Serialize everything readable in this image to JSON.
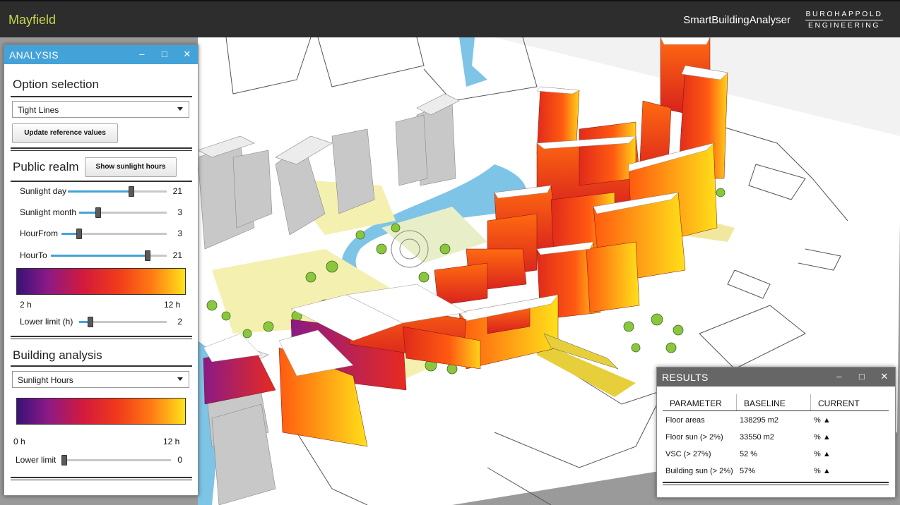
{
  "header": {
    "app_name": "Mayfield",
    "product_name": "SmartBuildingAnalyser",
    "brand_line1": "BUROHAPPOLD",
    "brand_line2": "ENGINEERING"
  },
  "analysis_panel": {
    "title": "ANALYSIS",
    "window_buttons": [
      "–",
      "□",
      "✕"
    ],
    "option_selection": {
      "heading": "Option selection",
      "dropdown_value": "Tight Lines",
      "update_button": "Update reference values"
    },
    "public_realm": {
      "heading": "Public realm",
      "show_button": "Show sunlight hours",
      "sliders": [
        {
          "label": "Sunlight day",
          "value": "21",
          "fraction": 0.65
        },
        {
          "label": "Sunlight month",
          "value": "3",
          "fraction": 0.2
        },
        {
          "label": "HourFrom",
          "value": "3",
          "fraction": 0.15
        },
        {
          "label": "HourTo",
          "value": "21",
          "fraction": 0.85
        }
      ],
      "scale_min": "2 h",
      "scale_max": "12 h",
      "lower_limit": {
        "label": "Lower limit (h)",
        "value": "2",
        "fraction": 0.1
      }
    },
    "building_analysis": {
      "heading": "Building analysis",
      "dropdown_value": "Sunlight Hours",
      "scale_min": "0 h",
      "scale_max": "12 h",
      "lower_limit": {
        "label": "Lower limit",
        "value": "0",
        "fraction": 0.0
      }
    }
  },
  "results_panel": {
    "title": "RESULTS",
    "window_buttons": [
      "–",
      "□",
      "✕"
    ],
    "columns": [
      "PARAMETER",
      "BASELINE",
      "CURRENT"
    ],
    "rows": [
      {
        "parameter": "Floor areas",
        "baseline": "138295 m2",
        "current": "% ▲"
      },
      {
        "parameter": "Floor sun (> 2%)",
        "baseline": "33550 m2",
        "current": "% ▲"
      },
      {
        "parameter": "VSC (> 27%)",
        "baseline": "52 %",
        "current": "% ▲"
      },
      {
        "parameter": "Building sun (> 2%)",
        "baseline": "57%",
        "current": "% ▲"
      }
    ]
  },
  "colors": {
    "accent": "#43a3d9",
    "app_name": "#c6d64c",
    "results_titlebar": "#666666",
    "topbar": "#2d2d2d"
  }
}
